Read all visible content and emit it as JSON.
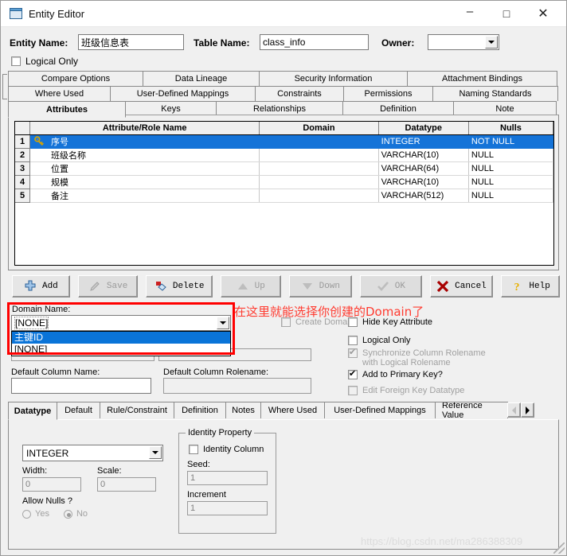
{
  "window": {
    "title": "Entity Editor",
    "icon": "entity-editor-icon",
    "minimize": "–",
    "maximize": "□",
    "close": "✕"
  },
  "header": {
    "entity_name_label": "Entity Name:",
    "entity_name_value": "班级信息表",
    "table_name_label": "Table Name:",
    "table_name_value": "class_info",
    "owner_label": "Owner:",
    "owner_value": "",
    "logical_only_label": "Logical Only",
    "logical_only_checked": false
  },
  "top_tabs": {
    "row1": [
      "Compare Options",
      "Data Lineage",
      "Security Information",
      "Attachment Bindings"
    ],
    "row2": [
      "Where Used",
      "User-Defined Mappings",
      "Constraints",
      "Permissions",
      "Naming Standards"
    ],
    "row3": [
      "Attributes",
      "Keys",
      "Relationships",
      "Definition",
      "Note"
    ],
    "selected": "Attributes"
  },
  "grid": {
    "columns": [
      "",
      "",
      "Attribute/Role Name",
      "Domain",
      "Datatype",
      "Nulls"
    ],
    "rows": [
      {
        "num": "1",
        "key": true,
        "attr": "序号",
        "domain": "",
        "datatype": "INTEGER",
        "nulls": "NOT NULL",
        "selected": true
      },
      {
        "num": "2",
        "key": false,
        "attr": "班级名称",
        "domain": "",
        "datatype": "VARCHAR(10)",
        "nulls": "NULL",
        "selected": false
      },
      {
        "num": "3",
        "key": false,
        "attr": "位置",
        "domain": "",
        "datatype": "VARCHAR(64)",
        "nulls": "NULL",
        "selected": false
      },
      {
        "num": "4",
        "key": false,
        "attr": "规模",
        "domain": "",
        "datatype": "VARCHAR(10)",
        "nulls": "NULL",
        "selected": false
      },
      {
        "num": "5",
        "key": false,
        "attr": "备注",
        "domain": "",
        "datatype": "VARCHAR(512)",
        "nulls": "NULL",
        "selected": false
      }
    ]
  },
  "buttons": [
    {
      "id": "add",
      "label": "Add",
      "accel": "A",
      "icon": "plus-icon",
      "enabled": true
    },
    {
      "id": "save",
      "label": "Save",
      "accel": "v",
      "icon": "pencil-icon",
      "enabled": false
    },
    {
      "id": "delete",
      "label": "Delete",
      "accel": "D",
      "icon": "eraser-icon",
      "enabled": true
    },
    {
      "id": "up",
      "label": "Up",
      "accel": "p",
      "icon": "triangle-up-icon",
      "enabled": false
    },
    {
      "id": "down",
      "label": "Down",
      "accel": "n",
      "icon": "triangle-down-icon",
      "enabled": false
    },
    {
      "id": "ok",
      "label": "OK",
      "accel": "K",
      "icon": "check-icon",
      "enabled": false
    },
    {
      "id": "cancel",
      "label": "Cancel",
      "accel": "",
      "icon": "x-icon",
      "enabled": true
    },
    {
      "id": "help",
      "label": "Help",
      "accel": "",
      "icon": "question-icon",
      "enabled": true
    }
  ],
  "annotation": {
    "text": "在这里就能选择你创建的Domain了",
    "color": "#ff3b30",
    "box_color": "#ff0000"
  },
  "properties": {
    "domain_label": "Domain Name:",
    "domain_value": "[NONE]",
    "domain_options": [
      "主键ID",
      "[NONE]"
    ],
    "domain_highlighted": "主键ID",
    "create_domain_label": "Create Domain",
    "create_domain_checked": false,
    "create_domain_enabled": false,
    "hide_key_attribute_label": "Hide Key Attribute",
    "hide_key_attribute_checked": false,
    "logical_only_label": "Logical Only",
    "logical_only_checked": false,
    "sync_label_line1": "Synchronize Column Rolename",
    "sync_label_line2": "with Logical Rolename",
    "sync_checked": true,
    "sync_enabled": false,
    "add_pk_label": "Add to Primary Key?",
    "add_pk_checked": true,
    "edit_fk_label": "Edit Foreign Key Datatype",
    "edit_fk_checked": false,
    "edit_fk_enabled": false,
    "default_column_name_label": "Default Column Name:",
    "default_column_name_value": "",
    "default_column_rolename_label": "Default Column Rolename:",
    "default_column_rolename_value": ""
  },
  "bottom_tabs": {
    "items": [
      "Datatype",
      "Default",
      "Rule/Constraint",
      "Definition",
      "Notes",
      "Where Used",
      "User-Defined Mappings",
      "Reference Value"
    ],
    "selected": "Datatype",
    "scroll_left": "scroll-left-icon",
    "scroll_right": "scroll-right-icon"
  },
  "datatype_pane": {
    "datatype_value": "INTEGER",
    "width_label": "Width:",
    "width_value": "0",
    "scale_label": "Scale:",
    "scale_value": "0",
    "allow_nulls_label": "Allow Nulls ?",
    "allow_nulls_yes": "Yes",
    "allow_nulls_no": "No",
    "allow_nulls_selected": "No",
    "identity_group_label": "Identity Property",
    "identity_column_label": "Identity Column",
    "identity_column_checked": false,
    "seed_label": "Seed:",
    "seed_value": "1",
    "increment_label": "Increment",
    "increment_value": "1"
  },
  "watermark": {
    "text": "https://blog.csdn.net/ma286388309"
  }
}
